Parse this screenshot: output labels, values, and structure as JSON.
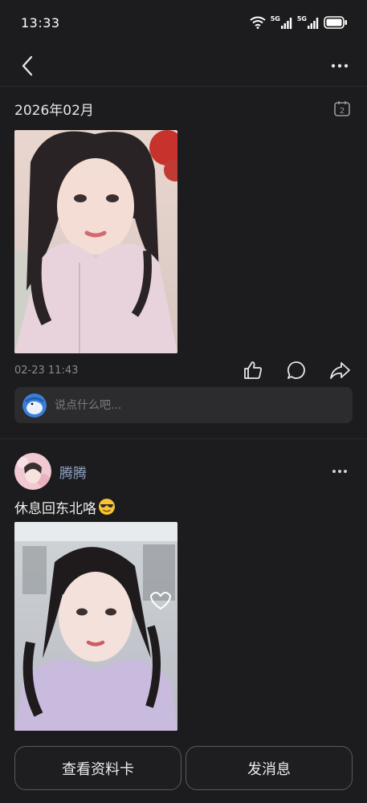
{
  "status_bar": {
    "time": "13:33",
    "icons": [
      "wifi-icon",
      "signal-5g-icon",
      "signal-5g-icon",
      "battery-icon"
    ],
    "network_label_1": "5G",
    "network_label_2": "5G"
  },
  "nav": {
    "back_icon": "chevron-left-icon",
    "more_icon": "more-dots-icon"
  },
  "feed": {
    "month": "2026年02月",
    "calendar_day": "2",
    "post1": {
      "timestamp": "02-23 11:43",
      "actions": [
        "like-icon",
        "comment-icon",
        "share-icon"
      ]
    },
    "comment_placeholder": "说点什么吧...",
    "post2": {
      "username": "腾腾",
      "text": "休息回东北咯"
    }
  },
  "bottom": {
    "profile_label": "查看资料卡",
    "message_label": "发消息"
  },
  "colors": {
    "background": "#1c1c1e",
    "username": "#8fa3c4",
    "muted": "#8a8a8e",
    "input_bg": "#2c2c2e"
  }
}
